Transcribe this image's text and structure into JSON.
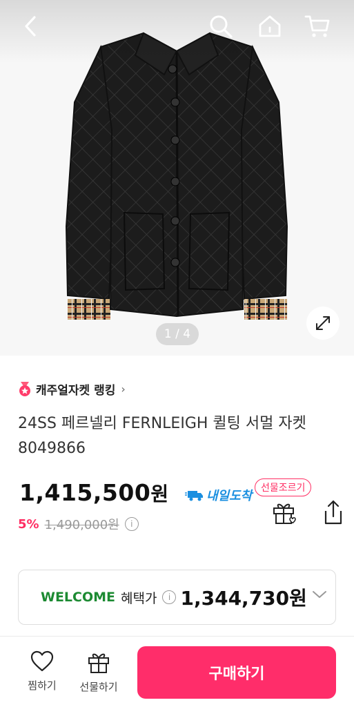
{
  "gallery": {
    "pager": "1 / 4"
  },
  "icons": {
    "back": "chevron-left-icon",
    "search": "search-icon",
    "home": "home-icon",
    "cart": "cart-icon",
    "expand": "expand-icon",
    "ranking": "ranking-badge-icon",
    "delivery": "truck-icon",
    "gift": "gift-icon",
    "share": "share-icon",
    "heart": "heart-icon"
  },
  "product": {
    "ranking_label": "캐주얼자켓 랭킹",
    "ranking_chevron": "›",
    "title": "24SS 페르넬리 FERNLEIGH 퀼팅 서멀 자켓 8049866",
    "price": "1,415,500",
    "price_unit": "원",
    "delivery_label": "내일도착",
    "gift_bubble": "선물조르기",
    "discount_rate": "5%",
    "original_price": "1,490,000원",
    "info_icon": "i"
  },
  "benefit": {
    "welcome": "WELCOME",
    "label": "혜택가",
    "price": "1,344,730원"
  },
  "bottom_bar": {
    "like_label": "찜하기",
    "gift_label": "선물하기",
    "buy_label": "구매하기"
  },
  "colors": {
    "accent": "#ff2d6a",
    "welcome_green": "#1c8a32",
    "delivery_blue": "#1a8fe0"
  }
}
